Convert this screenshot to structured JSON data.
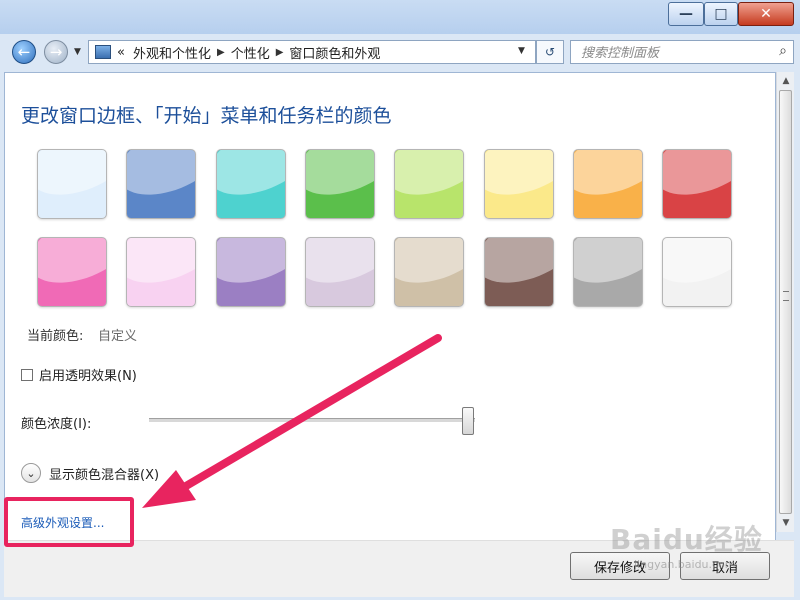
{
  "titlebar": {
    "minimize": "—",
    "maximize": "□",
    "close": "✕"
  },
  "nav": {
    "back": "←",
    "forward": "→",
    "dropdown": "▼"
  },
  "address": {
    "prefix": "«",
    "crumbs": [
      "外观和个性化",
      "个性化",
      "窗口颜色和外观"
    ],
    "dropdown": "▼"
  },
  "refresh": "↺",
  "search": {
    "placeholder": "搜索控制面板",
    "icon": "search-icon"
  },
  "main": {
    "heading": "更改窗口边框、「开始」菜单和任务栏的颜色",
    "swatches": [
      {
        "name": "sky",
        "color": "#dfeefc"
      },
      {
        "name": "twilight",
        "color": "#5b86c8"
      },
      {
        "name": "sea",
        "color": "#4ed2cf"
      },
      {
        "name": "leaf",
        "color": "#5bbf4b"
      },
      {
        "name": "lime",
        "color": "#b8e46b"
      },
      {
        "name": "lemon",
        "color": "#fbe98a"
      },
      {
        "name": "tangerine",
        "color": "#f9b149"
      },
      {
        "name": "ruby",
        "color": "#d94345"
      },
      {
        "name": "fuchsia",
        "color": "#f06ab6"
      },
      {
        "name": "blush",
        "color": "#f8d2f1"
      },
      {
        "name": "violet",
        "color": "#9b7fc3"
      },
      {
        "name": "lavender",
        "color": "#d8c9de"
      },
      {
        "name": "taupe",
        "color": "#cfc0a7"
      },
      {
        "name": "chocolate",
        "color": "#7d5c55"
      },
      {
        "name": "slate",
        "color": "#a9a9a9"
      },
      {
        "name": "frost",
        "color": "#f2f2f2"
      }
    ],
    "current_color_label": "当前颜色:",
    "current_color_value": "自定义",
    "transparency_label": "启用透明效果(N)",
    "transparency_checked": false,
    "intensity_label": "颜色浓度(I):",
    "intensity_value": 0.98,
    "mixer_label": "显示颜色混合器(X)",
    "advanced_link": "高级外观设置..."
  },
  "footer": {
    "save": "保存修改",
    "cancel": "取消"
  },
  "annotation": {
    "highlight_color": "#e8245f"
  },
  "watermark": {
    "text": "Baidu经验",
    "sub": "jingyan.baidu.com"
  }
}
